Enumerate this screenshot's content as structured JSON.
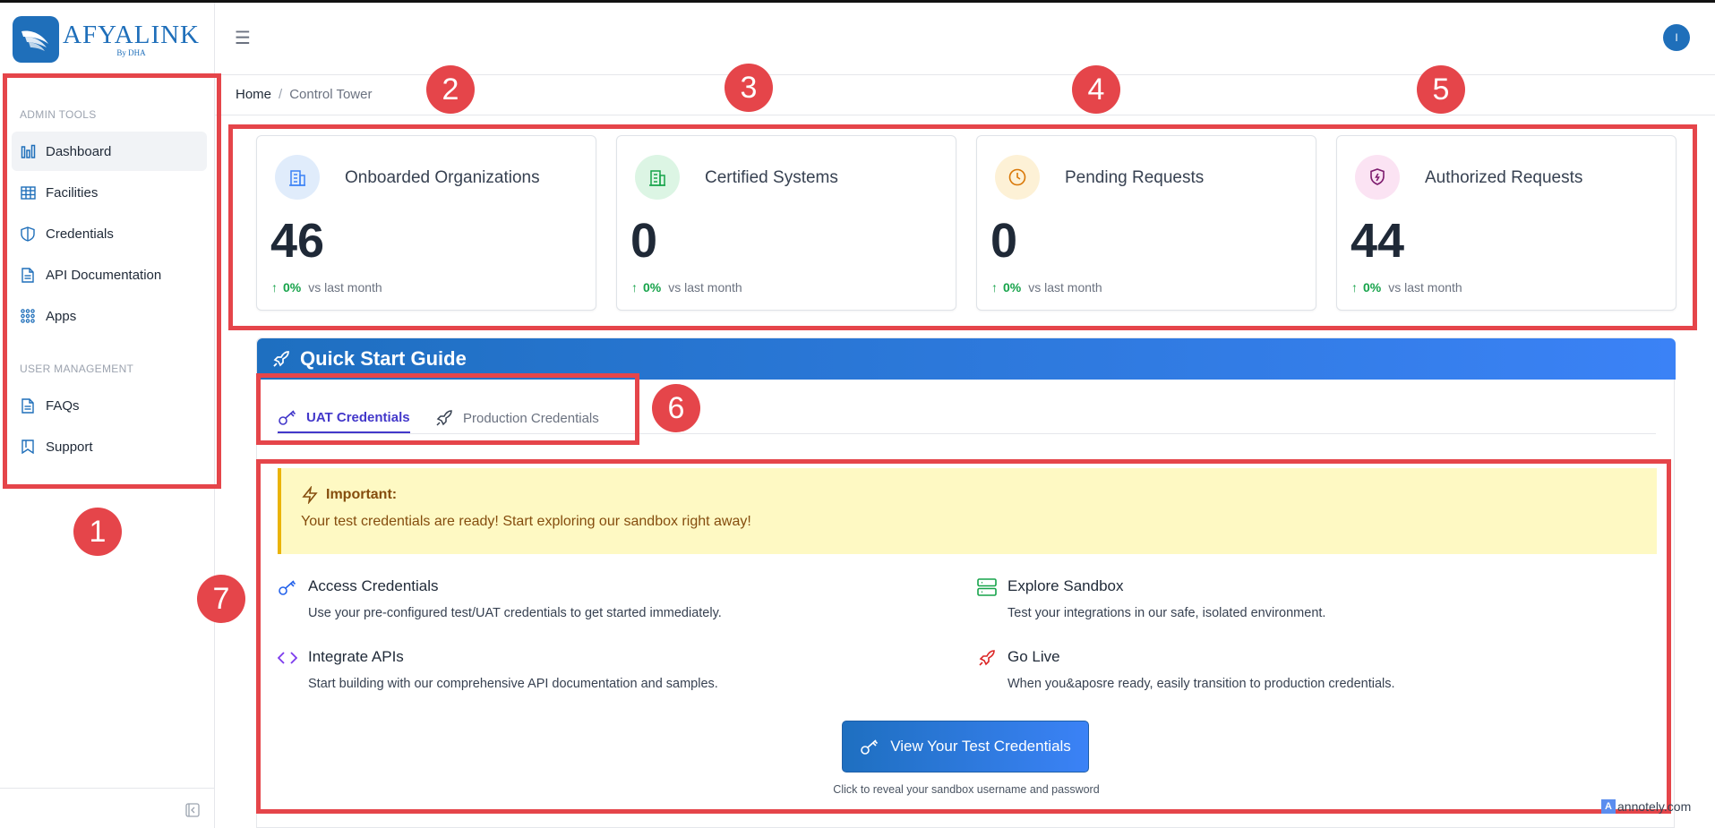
{
  "app": {
    "logo_name": "AFYALINK",
    "logo_sub": "By DHA",
    "brand_color": "#1f6fba",
    "avatar_initial": "I"
  },
  "sidebar": {
    "sections": [
      {
        "label": "ADMIN TOOLS"
      },
      {
        "label": "USER MANAGEMENT"
      }
    ],
    "items": [
      {
        "label": "Dashboard",
        "icon": "bar-chart-icon",
        "active": true
      },
      {
        "label": "Facilities",
        "icon": "table-icon"
      },
      {
        "label": "Credentials",
        "icon": "shield-icon"
      },
      {
        "label": "API Documentation",
        "icon": "document-icon"
      },
      {
        "label": "Apps",
        "icon": "grid-icon"
      },
      {
        "label": "FAQs",
        "icon": "document-icon"
      },
      {
        "label": "Support",
        "icon": "book-icon"
      }
    ]
  },
  "breadcrumb": {
    "home": "Home",
    "separator": "/",
    "current": "Control Tower"
  },
  "stats": [
    {
      "title": "Onboarded Organizations",
      "value": "46",
      "trend_arrow": "↑",
      "trend_pct": "0%",
      "trend_label": "vs last month",
      "icon": "building-icon",
      "icon_color": "#3b82f6",
      "icon_bg": "#e0ecfb"
    },
    {
      "title": "Certified Systems",
      "value": "0",
      "trend_arrow": "↑",
      "trend_pct": "0%",
      "trend_label": "vs last month",
      "icon": "building-icon",
      "icon_color": "#16a34a",
      "icon_bg": "#dcf5e4"
    },
    {
      "title": "Pending Requests",
      "value": "0",
      "trend_arrow": "↑",
      "trend_pct": "0%",
      "trend_label": "vs last month",
      "icon": "clock-icon",
      "icon_color": "#d97706",
      "icon_bg": "#fdf1d6"
    },
    {
      "title": "Authorized Requests",
      "value": "44",
      "trend_arrow": "↑",
      "trend_pct": "0%",
      "trend_label": "vs last month",
      "icon": "shield-icon",
      "icon_color": "#7e1d6f",
      "icon_bg": "#fbe3f3"
    }
  ],
  "quick_start": {
    "title": "Quick Start Guide",
    "tabs": [
      {
        "label": "UAT Credentials",
        "active": true
      },
      {
        "label": "Production Credentials",
        "active": false
      }
    ],
    "alert": {
      "title": "Important:",
      "text": "Your test credentials are ready! Start exploring our sandbox right away!"
    },
    "features": [
      {
        "title": "Access Credentials",
        "desc": "Use your pre-configured test/UAT credentials to get started immediately.",
        "icon": "key-icon"
      },
      {
        "title": "Explore Sandbox",
        "desc": "Test your integrations in our safe, isolated environment.",
        "icon": "server-icon"
      },
      {
        "title": "Integrate APIs",
        "desc": "Start building with our comprehensive API documentation and samples.",
        "icon": "code-icon"
      },
      {
        "title": "Go Live",
        "desc": "When you&aposre ready, easily transition to production credentials.",
        "icon": "rocket-icon"
      }
    ],
    "cta_label": "View Your Test Credentials",
    "cta_hint": "Click to reveal your sandbox username and password"
  },
  "annotations": [
    "1",
    "2",
    "3",
    "4",
    "5",
    "6",
    "7"
  ],
  "annotation_color": "#e5454a",
  "watermark": "annotely.com"
}
